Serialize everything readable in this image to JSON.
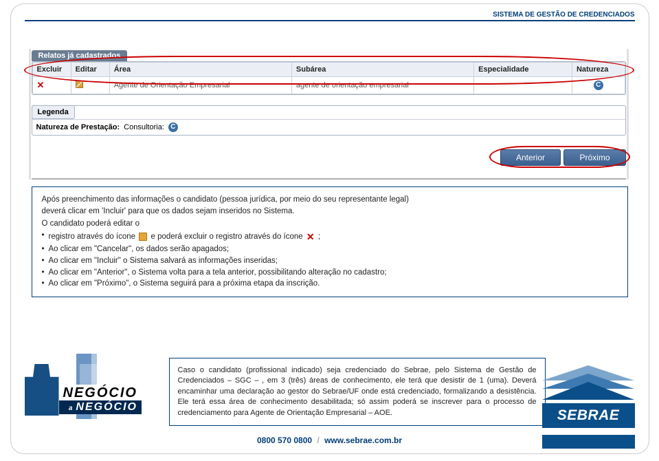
{
  "header": {
    "title": "SISTEMA DE GESTÃO DE CREDENCIADOS"
  },
  "screenshot": {
    "section_tab": "Relatos já cadastrados",
    "table": {
      "headers": [
        "Excluir",
        "Editar",
        "Área",
        "Subárea",
        "Especialidade",
        "Natureza"
      ],
      "row": {
        "area": "Agente de Orientação Empresarial",
        "subarea": "agente de orientação empresarial",
        "especialidade": "",
        "natureza_badge": "C"
      }
    },
    "legend": {
      "tab": "Legenda",
      "label": "Natureza de Prestação:",
      "value": "Consultoria:",
      "badge": "C"
    },
    "nav": {
      "prev": "Anterior",
      "next": "Próximo"
    }
  },
  "instructions": {
    "p1_a": "Após preenchimento das informações o candidato (pessoa jurídica, por meio do seu representante legal)",
    "p1_b": "deverá clicar em 'Incluir' para que os dados sejam inseridos no Sistema.",
    "p2": "O candidato poderá editar o",
    "li1_a": "registro através do ícone",
    "li1_b": "e poderá excluir o registro através do ícone",
    "li1_c": ";",
    "li2": "Ao clicar em \"Cancelar\", os dados serão apagados;",
    "li3": "Ao clicar em \"Incluir\" o Sistema salvará as informações inseridas;",
    "li4": "Ao clicar em \"Anterior\", o Sistema volta para a tela anterior, possibilitando alteração no cadastro;",
    "li5": "Ao clicar em \"Próximo\", o Sistema seguirá para a próxima etapa da inscrição."
  },
  "infobox": {
    "text": "Caso o candidato (profissional indicado) seja credenciado do Sebrae, pelo Sistema de Gestão de Credenciados – SGC – , em 3 (três) áreas de conhecimento, ele terá que desistir de  1 (uma). Deverá encaminhar uma declaração ao gestor do Sebrae/UF onde está credenciado, formalizando a desistência. Ele terá essa área de conhecimento desabilitada; só assim poderá se inscrever para o processo de credenciamento para Agente de Orientação Empresarial – AOE."
  },
  "logos": {
    "negocio_r1": "NEGÓCIO",
    "negocio_r2_small": "a",
    "negocio_r2": "NEGÓCIO",
    "sebrae": "SEBRAE"
  },
  "footer": {
    "phone": "0800 570 0800",
    "url": "www.sebrae.com.br"
  }
}
